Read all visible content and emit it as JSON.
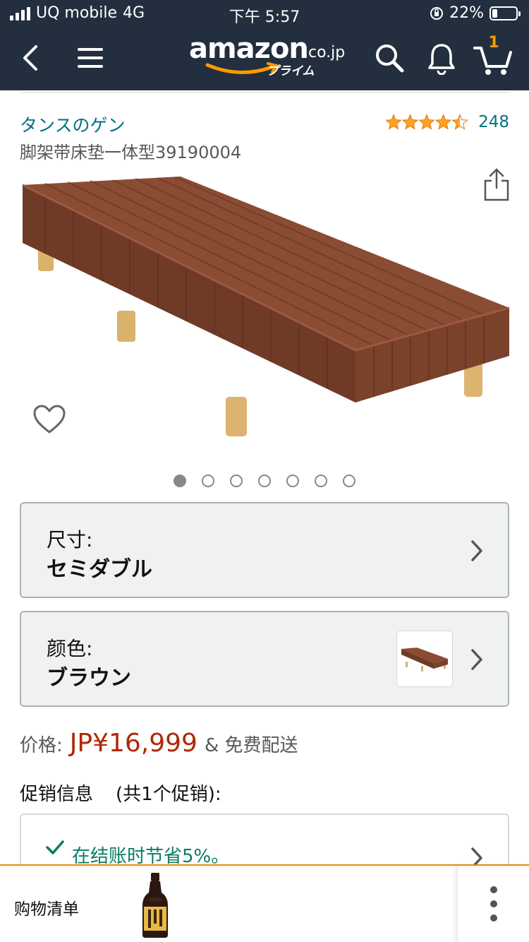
{
  "status_bar": {
    "carrier": "UQ mobile",
    "network": "4G",
    "time": "下午 5:57",
    "battery_percent": "22%",
    "battery_level": 0.22
  },
  "nav": {
    "logo_word": "amazon",
    "logo_tld": ".co.jp",
    "logo_prime": "プライム",
    "cart_count": "1",
    "icons": [
      "back-icon",
      "menu-icon",
      "search-icon",
      "bell-icon",
      "cart-icon"
    ]
  },
  "product": {
    "brand": "タンスのゲン",
    "title": "脚架带床垫一体型39190004",
    "rating_stars": 4.5,
    "rating_count": "248",
    "image_count": 7,
    "active_image": 0
  },
  "options": {
    "size_label": "尺寸:",
    "size_value": "セミダブル",
    "color_label": "颜色:",
    "color_value": "ブラウン"
  },
  "price": {
    "label": "价格:",
    "value": "JP¥16,999",
    "shipping": "& 免费配送"
  },
  "promotions": {
    "header": "促销信息",
    "count_text": "(共1个促销):",
    "item": "在结账时节省5%。"
  },
  "bottom_bar": {
    "list_label": "购物清单"
  },
  "colors": {
    "nav_bg": "#232f3e",
    "link": "#007185",
    "price": "#b12704",
    "promo_green": "#067d62",
    "star": "#ffa41c",
    "accent_orange": "#f08804"
  }
}
